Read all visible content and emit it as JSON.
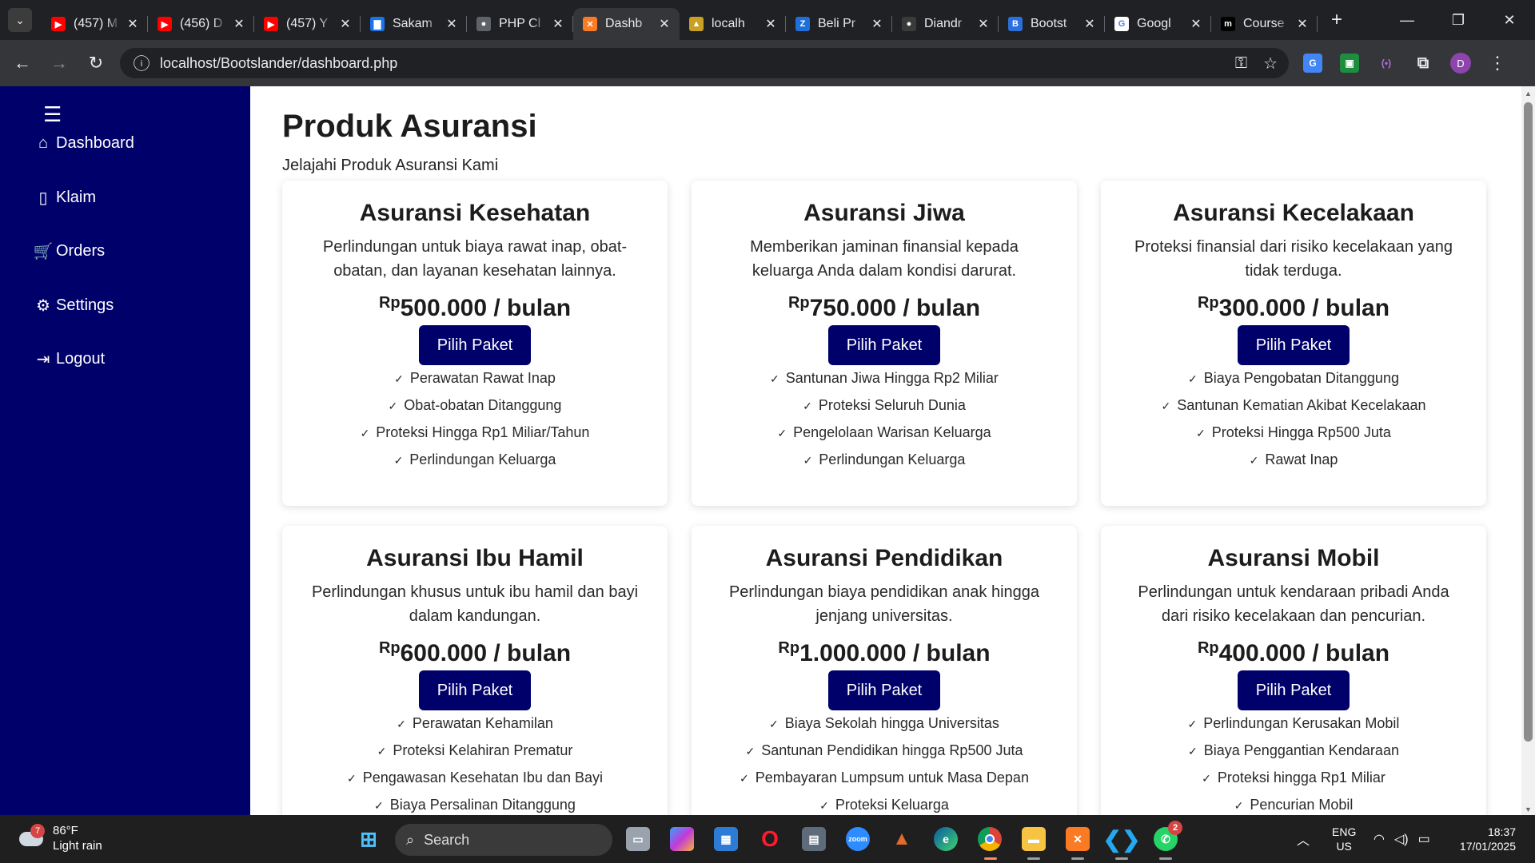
{
  "browser": {
    "tabs": [
      {
        "title": "(457) M",
        "favicon": "youtube-icon",
        "color": "#ff0000",
        "glyph": "▶"
      },
      {
        "title": "(456) D",
        "favicon": "youtube-icon",
        "color": "#ff0000",
        "glyph": "▶"
      },
      {
        "title": "(457) Y",
        "favicon": "youtube-icon",
        "color": "#ff0000",
        "glyph": "▶"
      },
      {
        "title": "Sakam",
        "favicon": "doc-icon",
        "color": "#1a73e8",
        "glyph": "▇"
      },
      {
        "title": "PHP Cl",
        "favicon": "github-icon",
        "color": "#5f6368",
        "glyph": "●"
      },
      {
        "title": "Dashb",
        "favicon": "xampp-icon",
        "color": "#fb7a24",
        "glyph": "✕"
      },
      {
        "title": "localh",
        "favicon": "codeigniter-icon",
        "color": "#c8a025",
        "glyph": "▲"
      },
      {
        "title": "Beli Pr",
        "favicon": "z-icon",
        "color": "#1e6fd9",
        "glyph": "Z"
      },
      {
        "title": "Diandr",
        "favicon": "github-icon",
        "color": "#3a3a3a",
        "glyph": "●"
      },
      {
        "title": "Bootst",
        "favicon": "bootstrap-icon",
        "color": "#2a6fdb",
        "glyph": "B"
      },
      {
        "title": "Googl",
        "favicon": "google-icon",
        "color": "#ffffff",
        "glyph": "G"
      },
      {
        "title": "Course",
        "favicon": "medium-icon",
        "color": "#000000",
        "glyph": "m"
      }
    ],
    "active_tab": 5,
    "url": "localhost/Bootslander/dashboard.php"
  },
  "sidebar": {
    "items": [
      {
        "label": "Dashboard",
        "icon": "home-icon"
      },
      {
        "label": "Klaim",
        "icon": "file-icon"
      },
      {
        "label": "Orders",
        "icon": "cart-icon"
      },
      {
        "label": "Settings",
        "icon": "gear-icon"
      },
      {
        "label": "Logout",
        "icon": "logout-icon"
      }
    ]
  },
  "main": {
    "title": "Produk Asuransi",
    "subtitle": "Jelajahi Produk Asuransi Kami",
    "button_label": "Pilih Paket",
    "currency": "Rp",
    "cards": [
      {
        "title": "Asuransi Kesehatan",
        "desc": "Perlindungan untuk biaya rawat inap, obat-obatan, dan layanan kesehatan lainnya.",
        "price": "500.000 / bulan",
        "features": [
          "Perawatan Rawat Inap",
          "Obat-obatan Ditanggung",
          "Proteksi Hingga Rp1 Miliar/Tahun",
          "Perlindungan Keluarga"
        ]
      },
      {
        "title": "Asuransi Jiwa",
        "desc": "Memberikan jaminan finansial kepada keluarga Anda dalam kondisi darurat.",
        "price": "750.000 / bulan",
        "features": [
          "Santunan Jiwa Hingga Rp2 Miliar",
          "Proteksi Seluruh Dunia",
          "Pengelolaan Warisan Keluarga",
          "Perlindungan Keluarga"
        ]
      },
      {
        "title": "Asuransi Kecelakaan",
        "desc": "Proteksi finansial dari risiko kecelakaan yang tidak terduga.",
        "price": "300.000 / bulan",
        "features": [
          "Biaya Pengobatan Ditanggung",
          "Santunan Kematian Akibat Kecelakaan",
          "Proteksi Hingga Rp500 Juta",
          "Rawat Inap"
        ]
      },
      {
        "title": "Asuransi Ibu Hamil",
        "desc": "Perlindungan khusus untuk ibu hamil dan bayi dalam kandungan.",
        "price": "600.000 / bulan",
        "features": [
          "Perawatan Kehamilan",
          "Proteksi Kelahiran Prematur",
          "Pengawasan Kesehatan Ibu dan Bayi",
          "Biaya Persalinan Ditanggung"
        ]
      },
      {
        "title": "Asuransi Pendidikan",
        "desc": "Perlindungan biaya pendidikan anak hingga jenjang universitas.",
        "price": "1.000.000 / bulan",
        "features": [
          "Biaya Sekolah hingga Universitas",
          "Santunan Pendidikan hingga Rp500 Juta",
          "Pembayaran Lumpsum untuk Masa Depan",
          "Proteksi Keluarga"
        ]
      },
      {
        "title": "Asuransi Mobil",
        "desc": "Perlindungan untuk kendaraan pribadi Anda dari risiko kecelakaan dan pencurian.",
        "price": "400.000 / bulan",
        "features": [
          "Perlindungan Kerusakan Mobil",
          "Biaya Penggantian Kendaraan",
          "Proteksi hingga Rp1 Miliar",
          "Pencurian Mobil"
        ]
      }
    ]
  },
  "taskbar": {
    "weather_temp": "86°F",
    "weather_desc": "Light rain",
    "weather_badge": "7",
    "search_label": "Search",
    "whatsapp_badge": "2",
    "lang_top": "ENG",
    "lang_bottom": "US",
    "time": "18:37",
    "date": "17/01/2025"
  },
  "colors": {
    "sidebar": "#00006b",
    "button": "#00006b"
  }
}
